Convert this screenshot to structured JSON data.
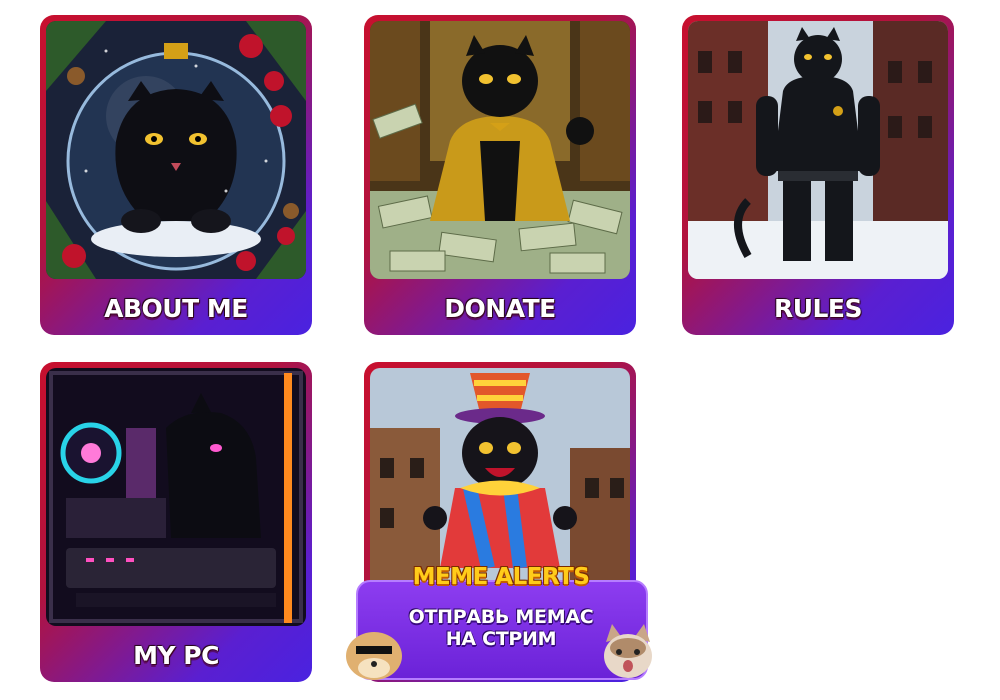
{
  "panels": [
    {
      "id": "about",
      "label": "ABOUT ME"
    },
    {
      "id": "donate",
      "label": "DONATE"
    },
    {
      "id": "rules",
      "label": "RULES"
    },
    {
      "id": "mypc",
      "label": "MY PC"
    },
    {
      "id": "memes",
      "label": ""
    }
  ],
  "meme_alerts": {
    "title": "MEME ALERTS",
    "line1": "ОТПРАВЬ МЕМАС",
    "line2": "НА СТРИМ"
  },
  "colors": {
    "panel_red": "#c8102e",
    "panel_purple": "#4a22e0",
    "meme_purple": "#7a2ee6",
    "meme_yellow": "#ffcc1a"
  }
}
